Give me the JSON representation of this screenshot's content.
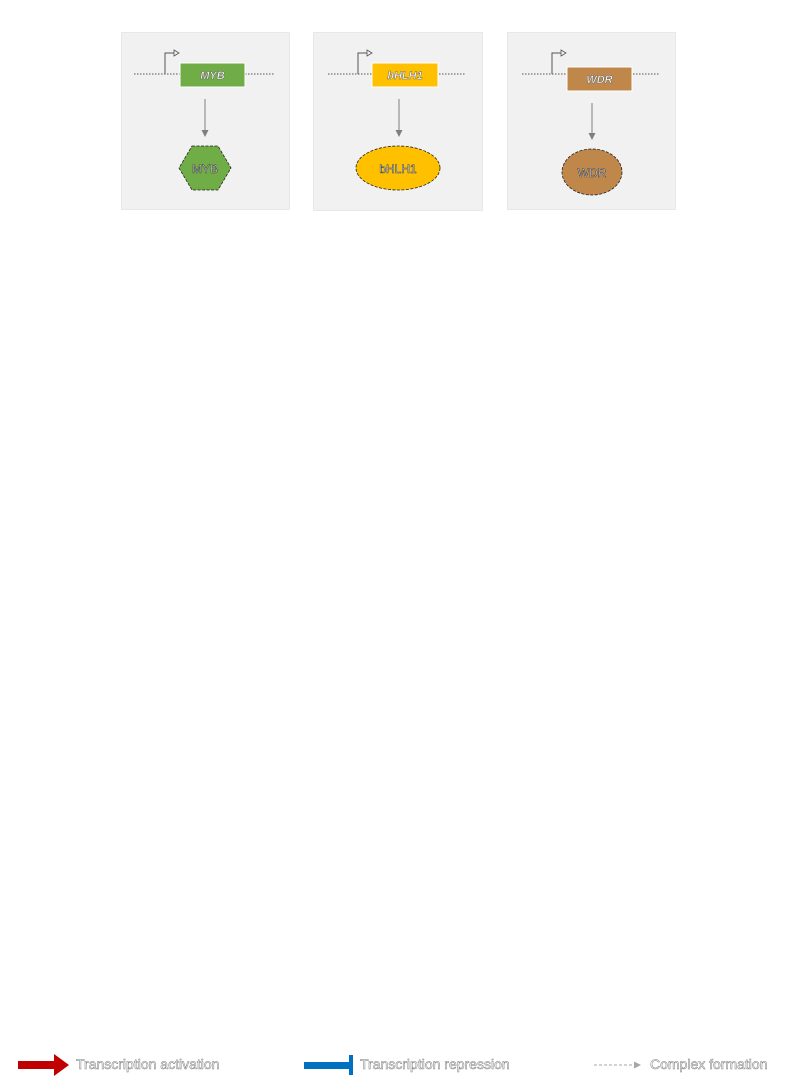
{
  "panels": [
    {
      "gene_label": "MYB",
      "protein_label": "MYB",
      "gene_color": "#70ad47",
      "protein_color": "#70ad47",
      "protein_shape": "hexagon"
    },
    {
      "gene_label": "bHLH1",
      "protein_label": "bHLH1",
      "gene_color": "#ffc000",
      "protein_color": "#ffc000",
      "protein_shape": "ellipse"
    },
    {
      "gene_label": "WDR",
      "protein_label": "WDR",
      "gene_color": "#c0874a",
      "protein_color": "#c0874a",
      "protein_shape": "circle"
    }
  ],
  "legend": {
    "activation": {
      "label": "Transcription activation",
      "color": "#c00000",
      "icon": "red-arrow-icon"
    },
    "repression": {
      "label": "Transcription repression",
      "color": "#0070c0",
      "icon": "blue-bar-icon"
    },
    "complex": {
      "label": "Complex formation",
      "color": "#a6a6a6",
      "icon": "dashed-arrow-icon"
    }
  }
}
